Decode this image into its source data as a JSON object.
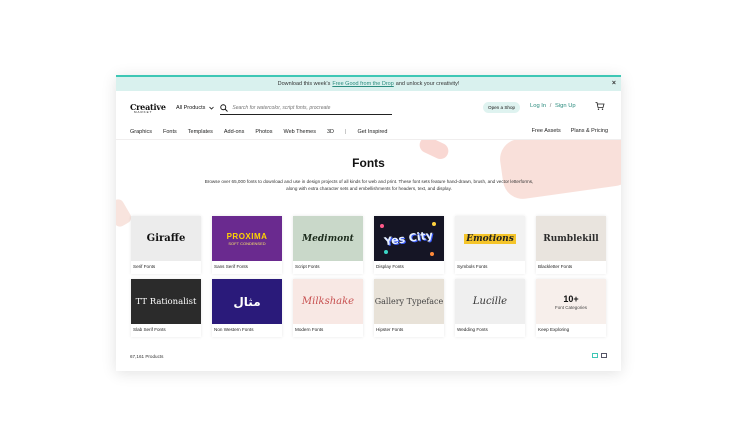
{
  "announcement": {
    "prefix": "Download this week's",
    "link": "Free Good from the Drop",
    "suffix": "and unlock your creativity!",
    "close": "×"
  },
  "header": {
    "logo_line1": "Creative",
    "logo_line2": "MARKET",
    "all_products": "All Products",
    "search_placeholder": "Search for watercolor, script fonts, procreate",
    "open_shop": "Open a Shop",
    "login": "Log In",
    "auth_sep": "/",
    "signup": "Sign Up"
  },
  "nav": {
    "items": [
      "Graphics",
      "Fonts",
      "Templates",
      "Add-ons",
      "Photos",
      "Web Themes",
      "3D",
      "|",
      "Get Inspired"
    ],
    "right": [
      "Free Assets",
      "Plans & Pricing"
    ]
  },
  "hero": {
    "title": "Fonts",
    "description": "Browse over 65,000 fonts to download and use in design projects of all kinds for web and print. These font sets feature hand-drawn, brush, and vector letterforms, along with extra character sets and embellishments for headers, text, and display."
  },
  "categories": [
    {
      "label": "Serif Fonts",
      "sample": "Giraffe"
    },
    {
      "label": "Sans Serif Fonts",
      "sample": "PROXIMA",
      "sample2": "SOFT CONDENSED"
    },
    {
      "label": "Script Fonts",
      "sample": "Medimont"
    },
    {
      "label": "Display Fonts",
      "sample": "Yes City"
    },
    {
      "label": "Symbols Fonts",
      "sample": "Emotions"
    },
    {
      "label": "Blackletter Fonts",
      "sample": "Rumblekill"
    },
    {
      "label": "Slab Serif Fonts",
      "sample": "TT Rationalist"
    },
    {
      "label": "Non Western Fonts",
      "sample": "مثال"
    },
    {
      "label": "Modern Fonts",
      "sample": "Milkshake"
    },
    {
      "label": "Hipster Fonts",
      "sample": "Gallery Typeface"
    },
    {
      "label": "Wedding Fonts",
      "sample": "Lucille"
    },
    {
      "label": "Keep Exploring",
      "sample": "10+",
      "sample2": "Font Categories"
    }
  ],
  "footer": {
    "count": "67,161 Products"
  },
  "colors": {
    "accent": "#3ec7b5",
    "link": "#2b8c7e"
  }
}
